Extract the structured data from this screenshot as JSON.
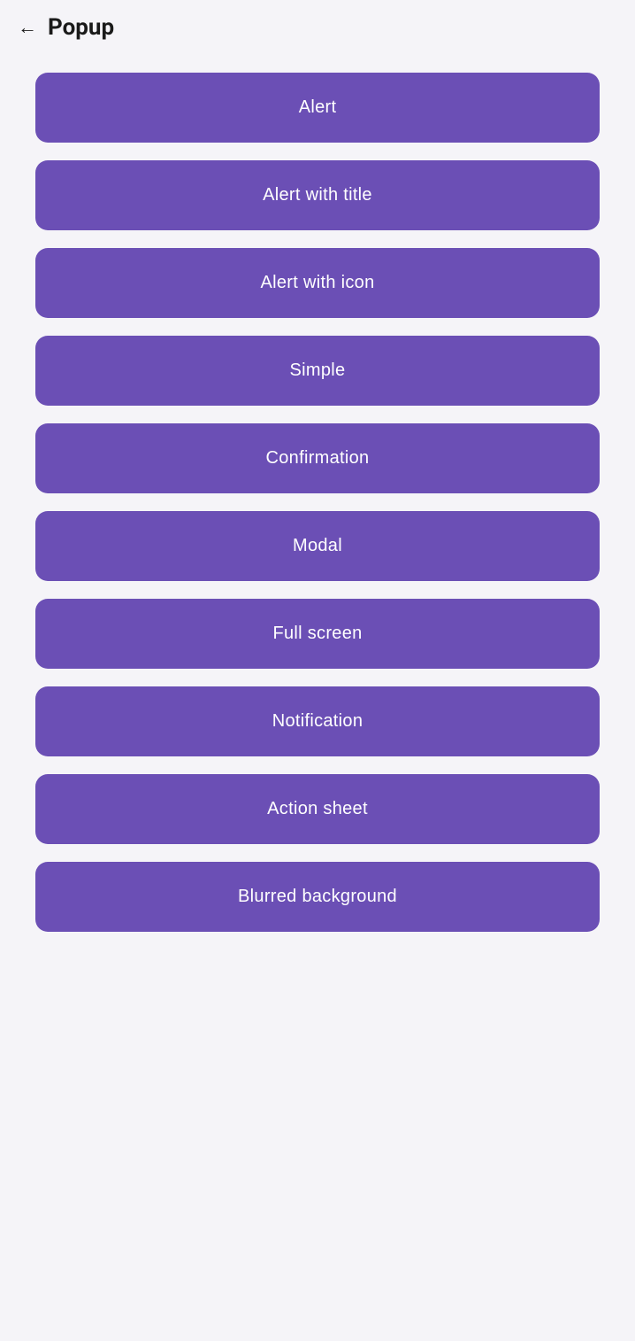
{
  "header": {
    "title": "Popup",
    "back_label": "←"
  },
  "buttons": [
    {
      "id": "alert",
      "label": "Alert"
    },
    {
      "id": "alert-with-title",
      "label": "Alert with title"
    },
    {
      "id": "alert-with-icon",
      "label": "Alert with icon"
    },
    {
      "id": "simple",
      "label": "Simple"
    },
    {
      "id": "confirmation",
      "label": "Confirmation"
    },
    {
      "id": "modal",
      "label": "Modal"
    },
    {
      "id": "full-screen",
      "label": "Full screen"
    },
    {
      "id": "notification",
      "label": "Notification"
    },
    {
      "id": "action-sheet",
      "label": "Action sheet"
    },
    {
      "id": "blurred-background",
      "label": "Blurred background"
    }
  ],
  "colors": {
    "button_bg": "#6b4fb5",
    "page_bg": "#f5f4f8",
    "button_text": "#ffffff",
    "title_color": "#1a1a1a"
  }
}
